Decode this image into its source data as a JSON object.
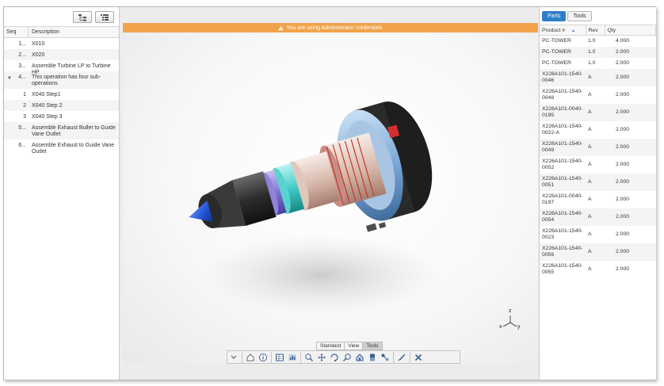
{
  "operations": {
    "columns": {
      "seq": "Seq",
      "description": "Description"
    },
    "rows": [
      {
        "seq": "1...",
        "description": "X010"
      },
      {
        "seq": "2...",
        "description": "X020"
      },
      {
        "seq": "3...",
        "description": "Assemble Turbine LP to Turbine HP"
      },
      {
        "seq": "4...",
        "description": "This operation has four sub-operations",
        "expanded": true
      },
      {
        "seq": "1",
        "description": "X040 Step1"
      },
      {
        "seq": "2",
        "description": "X040 Step 2"
      },
      {
        "seq": "3",
        "description": "X040 Step 3"
      },
      {
        "seq": "5...",
        "description": "Assemble Exhaust Bullet to Guide Vane Outlet"
      },
      {
        "seq": "6...",
        "description": "Assemble Exhaust to Guide Vane Outlet"
      }
    ]
  },
  "viewer": {
    "warning": "You are using Administrator credentials",
    "warning_color": "#f0a34a",
    "axis": {
      "z": "z",
      "x": "x",
      "y": "y"
    },
    "tabs": [
      "Standard",
      "View",
      "Tools"
    ],
    "active_tab": "Tools",
    "tool_icons": [
      "chevron-down-icon",
      "home-icon",
      "info-icon",
      "table-icon",
      "chart-icon",
      "zoom-icon",
      "pan-icon",
      "rotate-icon",
      "lasso-zoom-icon",
      "fit-icon",
      "section-icon",
      "explode-icon",
      "measure-icon",
      "close-icon"
    ]
  },
  "parts": {
    "tabs": [
      "Parts",
      "Tools"
    ],
    "active_tab": "Parts",
    "accent": "#2f7fc8",
    "columns": {
      "product": "Product #",
      "rev": "Rev",
      "qty": "Qty"
    },
    "rows": [
      {
        "product": "PC-TOWER",
        "rev": "1.0",
        "qty": "4.000"
      },
      {
        "product": "PC-TOWER",
        "rev": "1.0",
        "qty": "2.000"
      },
      {
        "product": "PC-TOWER",
        "rev": "1.0",
        "qty": "2.000"
      },
      {
        "product": "X226A101-1540-0046",
        "rev": "A",
        "qty": "2.000"
      },
      {
        "product": "X226A101-1540-0048",
        "rev": "A",
        "qty": "2.000"
      },
      {
        "product": "X226A101-0040-0195",
        "rev": "A",
        "qty": "2.000"
      },
      {
        "product": "X226A101-1540-0022-A",
        "rev": "A",
        "qty": "2.000"
      },
      {
        "product": "X226A101-1540-0049",
        "rev": "A",
        "qty": "2.000"
      },
      {
        "product": "X226A101-1540-0052",
        "rev": "A",
        "qty": "2.000"
      },
      {
        "product": "X226A101-1540-0051",
        "rev": "A",
        "qty": "2.000"
      },
      {
        "product": "X226A101-0040-0197",
        "rev": "A",
        "qty": "2.000"
      },
      {
        "product": "X226A101-1540-0054",
        "rev": "A",
        "qty": "2.000"
      },
      {
        "product": "X226A101-1540-0023",
        "rev": "A",
        "qty": "2.000"
      },
      {
        "product": "X226A101-1540-0056",
        "rev": "A",
        "qty": "2.000"
      },
      {
        "product": "X226A101-1540-0055",
        "rev": "A",
        "qty": "2.000"
      }
    ]
  }
}
